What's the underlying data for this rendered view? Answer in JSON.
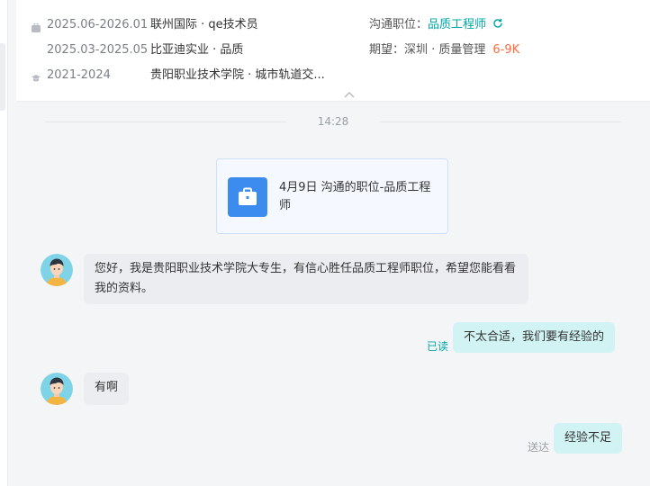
{
  "resume": {
    "rows": [
      {
        "icon": "briefcase-icon",
        "date": "2025.06-2026.01",
        "org": "联州国际 · qe技术员",
        "key": "沟通职位：",
        "value": "品质工程师"
      },
      {
        "icon": "",
        "date": "2025.03-2025.05",
        "org": "比亚迪实业 · 品质",
        "key": "期望：",
        "value": "深圳 · 质量管理",
        "salary": "6-9K"
      },
      {
        "icon": "graduation-cap-icon",
        "date": "2021-2024",
        "org": "贵阳职业技术学院 · 城市轨道交..."
      }
    ]
  },
  "chat": {
    "time": "14:28",
    "job_card": {
      "icon": "briefcase-icon",
      "text": "4月9日 沟通的职位-品质工程师"
    },
    "messages": [
      {
        "side": "in",
        "text": "您好，我是贵阳职业技术学院大专生，有信心胜任品质工程师职位，希望您能看看我的资料。"
      },
      {
        "side": "out",
        "text": "不太合适，我们要有经验的",
        "status": "已读"
      },
      {
        "side": "in",
        "text": "有啊"
      },
      {
        "side": "out",
        "text": "经验不足",
        "status": "送达"
      }
    ]
  },
  "colors": {
    "accent": "#00a6a7",
    "salary": "#ff6b3d",
    "out_bubble": "#d2f3f4",
    "in_bubble": "#ebedf0",
    "job_icon": "#3c8cf0"
  }
}
